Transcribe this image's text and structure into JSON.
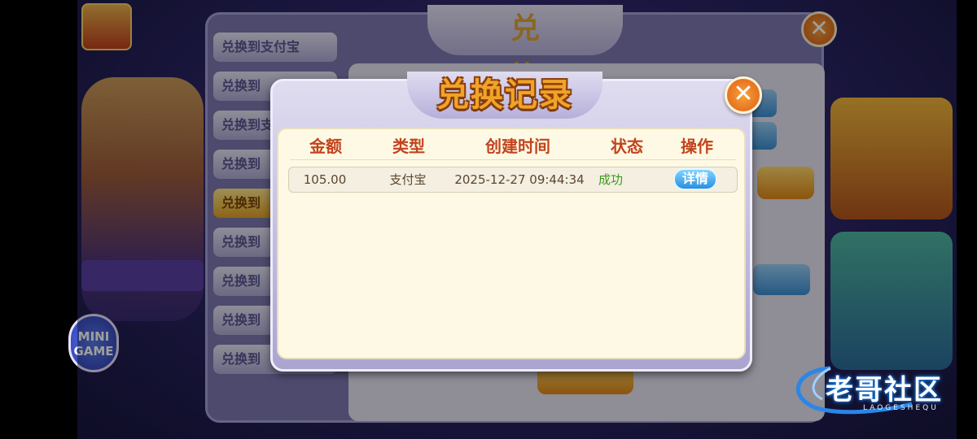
{
  "background": {
    "exchange_title": "兑 换",
    "exchange_tabs": [
      "兑换到支付宝",
      "兑换到",
      "兑换到支付",
      "兑换到",
      "兑换到",
      "兑换到",
      "兑换到",
      "兑换到",
      "兑换到"
    ],
    "mini_game_label": "MINI GAME"
  },
  "modal": {
    "title": "兑换记录",
    "close_icon": "close-icon",
    "columns": [
      "金额",
      "类型",
      "创建时间",
      "状态",
      "操作"
    ],
    "rows": [
      {
        "amount": "105.00",
        "type": "支付宝",
        "created_time": "2025-12-27 09:44:34",
        "status": "成功",
        "action_label": "详情"
      }
    ]
  },
  "watermark": {
    "text": "老哥社区",
    "sub": "LAOGESHEQU"
  },
  "colors": {
    "title": "#f0a327",
    "header_text": "#c2441e",
    "success": "#3b9a1e",
    "close_button": "#df5c16",
    "detail_button": "#2a8fe0"
  }
}
